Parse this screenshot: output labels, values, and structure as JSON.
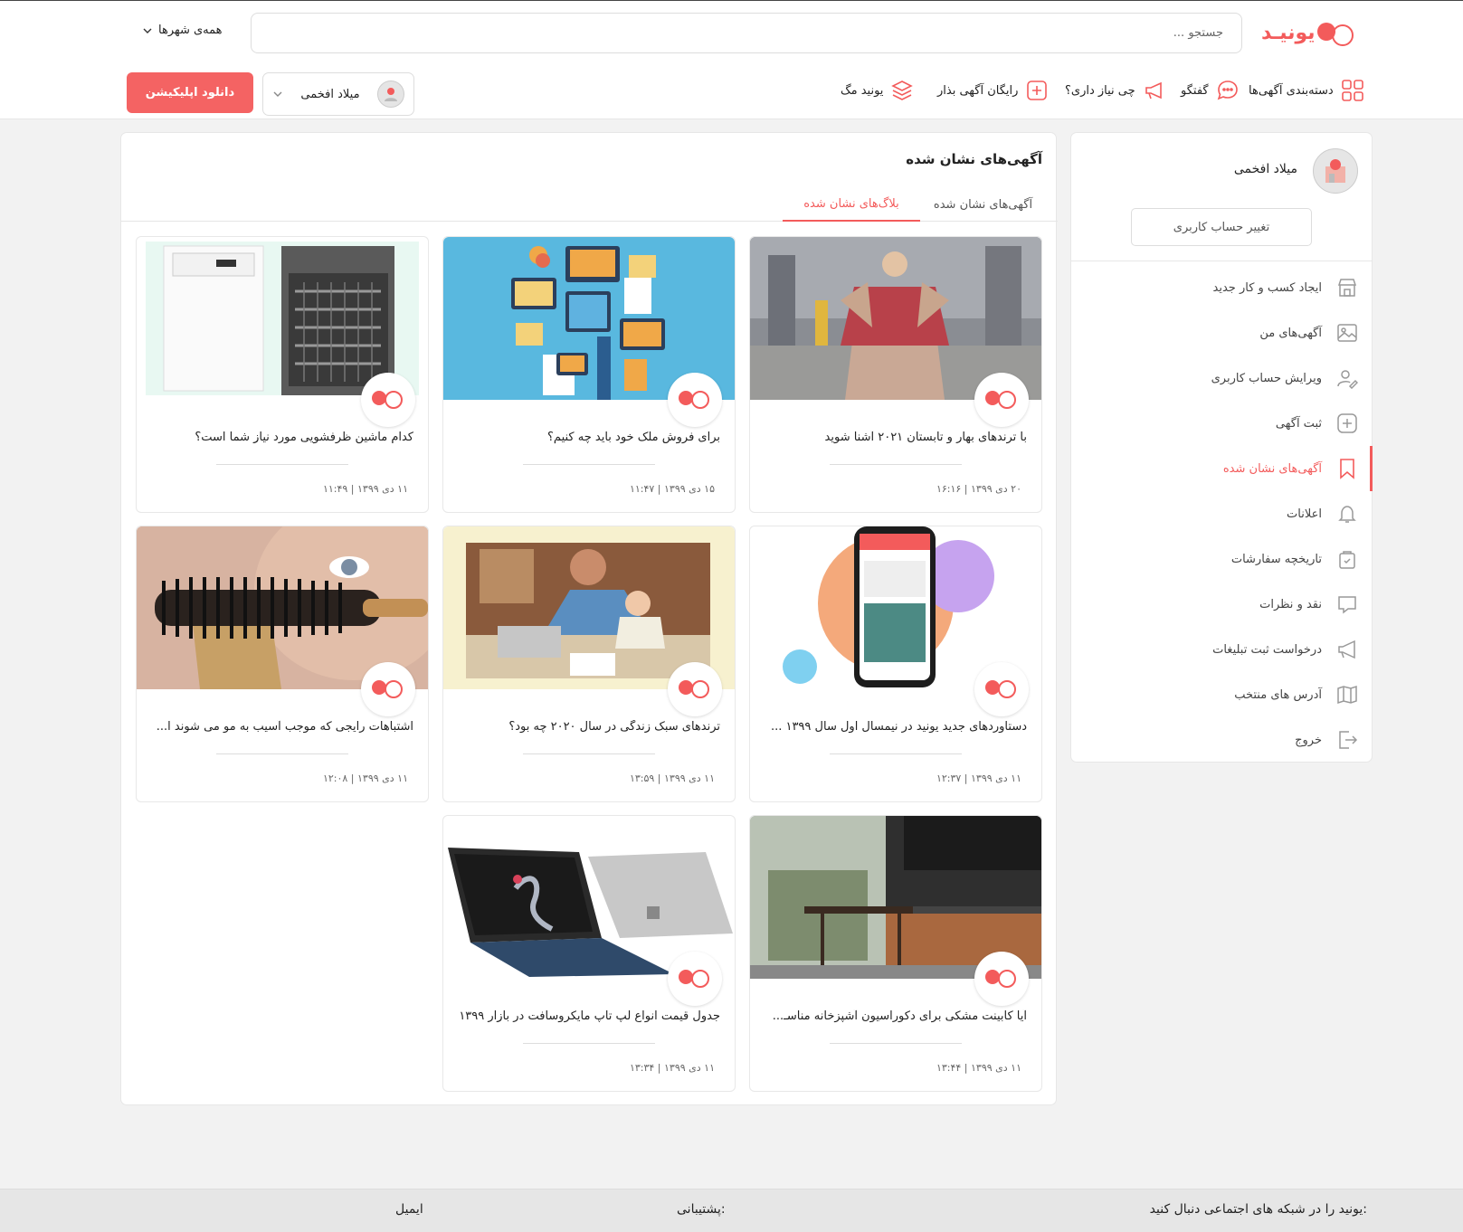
{
  "header": {
    "logo_text": "یونیـد",
    "search_placeholder": "جستجو ...",
    "city_label": "همه‌ی شهرها",
    "nav": {
      "categories": "دسته‌بندی آگهی‌ها",
      "chat": "گفتگو",
      "needs": "چی نیاز داری؟",
      "free_ad": "رایگان آگهی بذار",
      "mag": "یونید مگ"
    },
    "user_name": "میلاد افخمی",
    "download_app": "دانلود اپلیکیشن"
  },
  "main": {
    "title": "آگهی‌های نشان شده",
    "tabs": [
      {
        "label": "آگهی‌های نشان شده",
        "active": false
      },
      {
        "label": "بلاگ‌های نشان شده",
        "active": true
      }
    ],
    "cards": [
      {
        "title": "با ترندهای بهار و تابستان ۲۰۲۱ آشنا شوید",
        "date": "۲۰ دی ۱۳۹۹ | ۱۶:۱۶",
        "image": "fashion-photo"
      },
      {
        "title": "برای فروش ملک خود باید چه کنیم؟",
        "date": "۱۵ دی ۱۳۹۹ | ۱۱:۴۷",
        "image": "property-illustration"
      },
      {
        "title": "کدام ماشین ظرفشویی مورد نیاز شما است؟",
        "date": "۱۱ دی ۱۳۹۹ | ۱۱:۴۹",
        "image": "dishwasher-photo"
      },
      {
        "title": "دستاوردهای جدید یونید در نیمسال اول سال ۱۳۹۹ ...",
        "date": "۱۱ دی ۱۳۹۹ | ۱۲:۳۷",
        "image": "app-phone"
      },
      {
        "title": "ترندهای سبک زندگی در سال ۲۰۲۰ چه بود؟",
        "date": "۱۱ دی ۱۳۹۹ | ۱۳:۵۹",
        "image": "father-child-photo"
      },
      {
        "title": "اشتباهات رایجی که موجب آسیب به مو می شوند ا...",
        "date": "۱۱ دی ۱۳۹۹ | ۱۲:۰۸",
        "image": "hairbrush-photo"
      },
      {
        "title": "آیا کابینت مشکی برای دکوراسیون آشپزخانه مناسـ...",
        "date": "۱۱ دی ۱۳۹۹ | ۱۳:۴۴",
        "image": "kitchen-photo"
      },
      {
        "title": "جدول قیمت انواع لپ تاپ مایکروسافت در بازار ۱۳۹۹",
        "date": "۱۱ دی ۱۳۹۹ | ۱۳:۳۴",
        "image": "surface-laptop-photo"
      }
    ]
  },
  "sidebar": {
    "user_name": "میلاد افخمی",
    "switch_account": "تغییر حساب کاربری",
    "menu": [
      {
        "label": "ایجاد کسب و کار جدید",
        "icon": "store-icon",
        "active": false
      },
      {
        "label": "آگهی‌های من",
        "icon": "image-icon",
        "active": false
      },
      {
        "label": "ویرایش حساب کاربری",
        "icon": "user-edit-icon",
        "active": false
      },
      {
        "label": "ثبت آگهی",
        "icon": "plus-square-icon",
        "active": false
      },
      {
        "label": "آگهی‌های نشان شده",
        "icon": "bookmark-icon",
        "active": true
      },
      {
        "label": "اعلانات",
        "icon": "bell-icon",
        "active": false
      },
      {
        "label": "تاریخچه سفارشات",
        "icon": "bag-icon",
        "active": false
      },
      {
        "label": "نقد و نظرات",
        "icon": "comment-icon",
        "active": false
      },
      {
        "label": "درخواست ثبت تبلیغات",
        "icon": "megaphone-icon",
        "active": false
      },
      {
        "label": "آدرس های منتخب",
        "icon": "map-icon",
        "active": false
      },
      {
        "label": "خروج",
        "icon": "logout-icon",
        "active": false
      }
    ]
  },
  "footer": {
    "follow": "یونید را در شبکه های اجتماعی دنبال کنید:",
    "support": "پشتیبانی:",
    "email": "ایمیل"
  },
  "colors": {
    "accent": "#f35b5b",
    "background": "#f2f2f2"
  }
}
